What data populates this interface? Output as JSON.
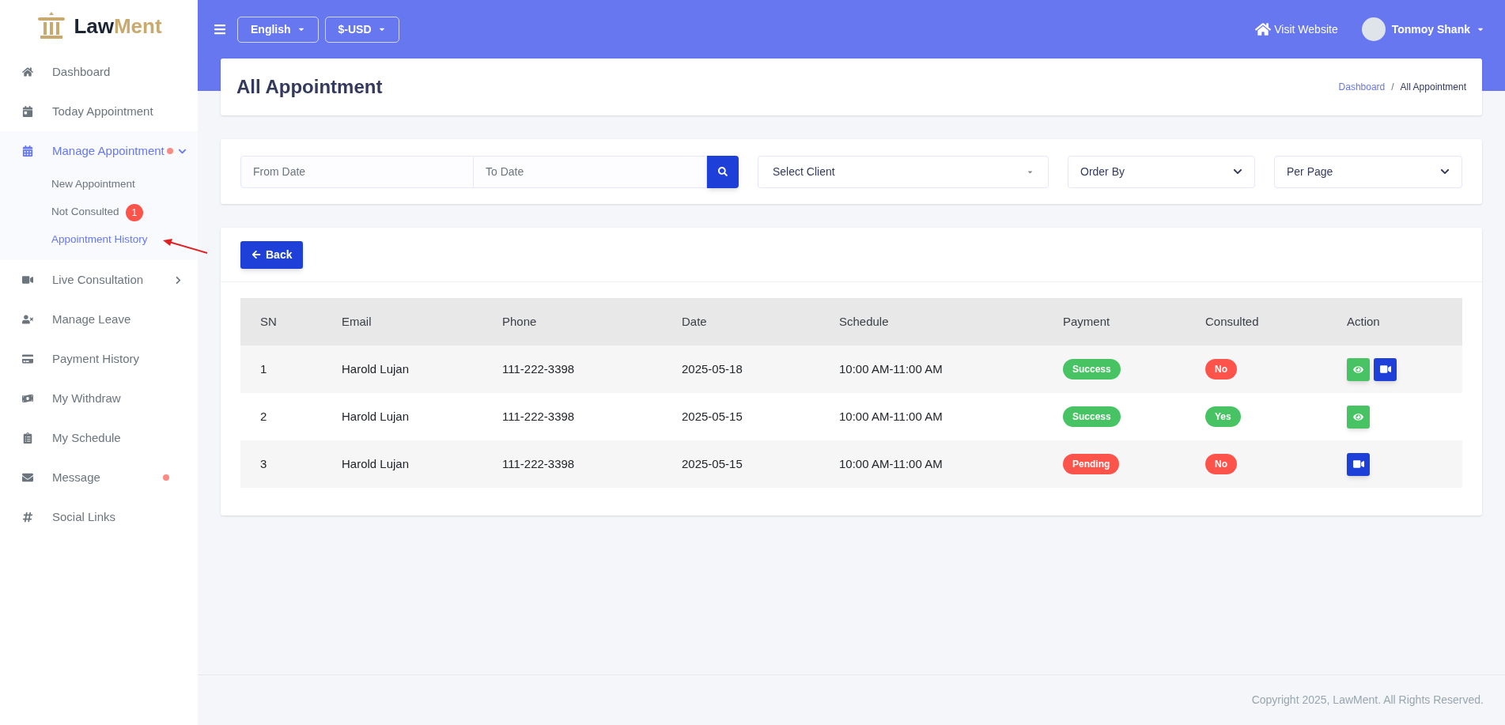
{
  "brand": {
    "first": "Law",
    "second": "Ment"
  },
  "sidebar": {
    "items": [
      {
        "label": "Dashboard",
        "selected": false
      },
      {
        "label": "Today Appointment",
        "selected": false
      },
      {
        "label": "Manage Appointment",
        "selected": true,
        "expanded": true,
        "dot": true,
        "children": [
          {
            "label": "New Appointment",
            "selected": false
          },
          {
            "label": "Not Consulted",
            "selected": false,
            "badge": "1"
          },
          {
            "label": "Appointment History",
            "selected": true
          }
        ]
      },
      {
        "label": "Live Consultation",
        "selected": false,
        "expanded": false
      },
      {
        "label": "Manage Leave",
        "selected": false
      },
      {
        "label": "Payment History",
        "selected": false
      },
      {
        "label": "My Withdraw",
        "selected": false
      },
      {
        "label": "My Schedule",
        "selected": false
      },
      {
        "label": "Message",
        "selected": false,
        "dot": true
      },
      {
        "label": "Social Links",
        "selected": false
      }
    ]
  },
  "topbar": {
    "language": "English",
    "currency": "$-USD",
    "visit": "Visit Website",
    "user": "Tonmoy Shank"
  },
  "page": {
    "title": "All Appointment",
    "breadcrumb": [
      "Dashboard",
      "/",
      "All Appointment"
    ]
  },
  "filters": {
    "from_placeholder": "From Date",
    "to_placeholder": "To Date",
    "client": "Select Client",
    "order": "Order By",
    "per_page": "Per Page"
  },
  "back": "Back",
  "table": {
    "columns": [
      "SN",
      "Email",
      "Phone",
      "Date",
      "Schedule",
      "Payment",
      "Consulted",
      "Action"
    ],
    "rows": [
      {
        "sn": "1",
        "email": "Harold Lujan",
        "phone": "111-222-3398",
        "date": "2025-05-18",
        "schedule": "10:00 AM-11:00 AM",
        "payment": {
          "text": "Success",
          "kind": "success"
        },
        "consulted": {
          "text": "No",
          "kind": "danger"
        },
        "actions": [
          {
            "kind": "view"
          },
          {
            "kind": "video"
          }
        ]
      },
      {
        "sn": "2",
        "email": "Harold Lujan",
        "phone": "111-222-3398",
        "date": "2025-05-15",
        "schedule": "10:00 AM-11:00 AM",
        "payment": {
          "text": "Success",
          "kind": "success"
        },
        "consulted": {
          "text": "Yes",
          "kind": "success"
        },
        "actions": [
          {
            "kind": "view"
          }
        ]
      },
      {
        "sn": "3",
        "email": "Harold Lujan",
        "phone": "111-222-3398",
        "date": "2025-05-15",
        "schedule": "10:00 AM-11:00 AM",
        "payment": {
          "text": "Pending",
          "kind": "danger"
        },
        "consulted": {
          "text": "No",
          "kind": "danger"
        },
        "actions": [
          {
            "kind": "video"
          }
        ]
      }
    ]
  },
  "footer": "Copyright 2025, LawMent. All Rights Reserved."
}
